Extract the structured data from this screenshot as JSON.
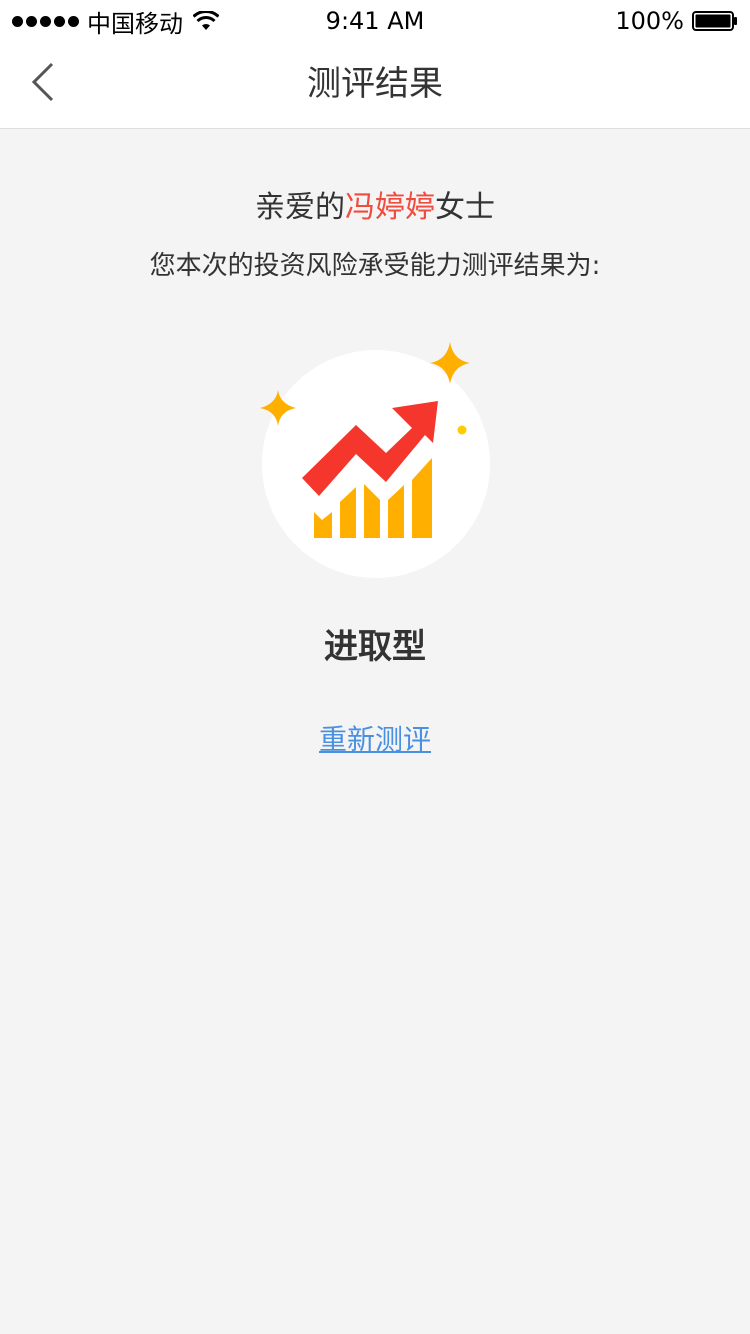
{
  "status_bar": {
    "carrier": "中国移动",
    "time": "9:41 AM",
    "battery": "100%"
  },
  "nav": {
    "back_icon": "chevron-left-icon",
    "title": "测评结果"
  },
  "greeting": {
    "prefix": "亲爱的",
    "name": "冯婷婷",
    "suffix": "女士"
  },
  "subtitle": "您本次的投资风险承受能力测评结果为:",
  "result": {
    "type": "进取型",
    "icon": "rising-chart-icon"
  },
  "retest": {
    "label": "重新测评"
  },
  "colors": {
    "name_highlight": "#f04b3f",
    "link": "#4a90e2",
    "arrow": "#f5362d",
    "bars": "#ffaf00",
    "background": "#f4f4f4"
  }
}
